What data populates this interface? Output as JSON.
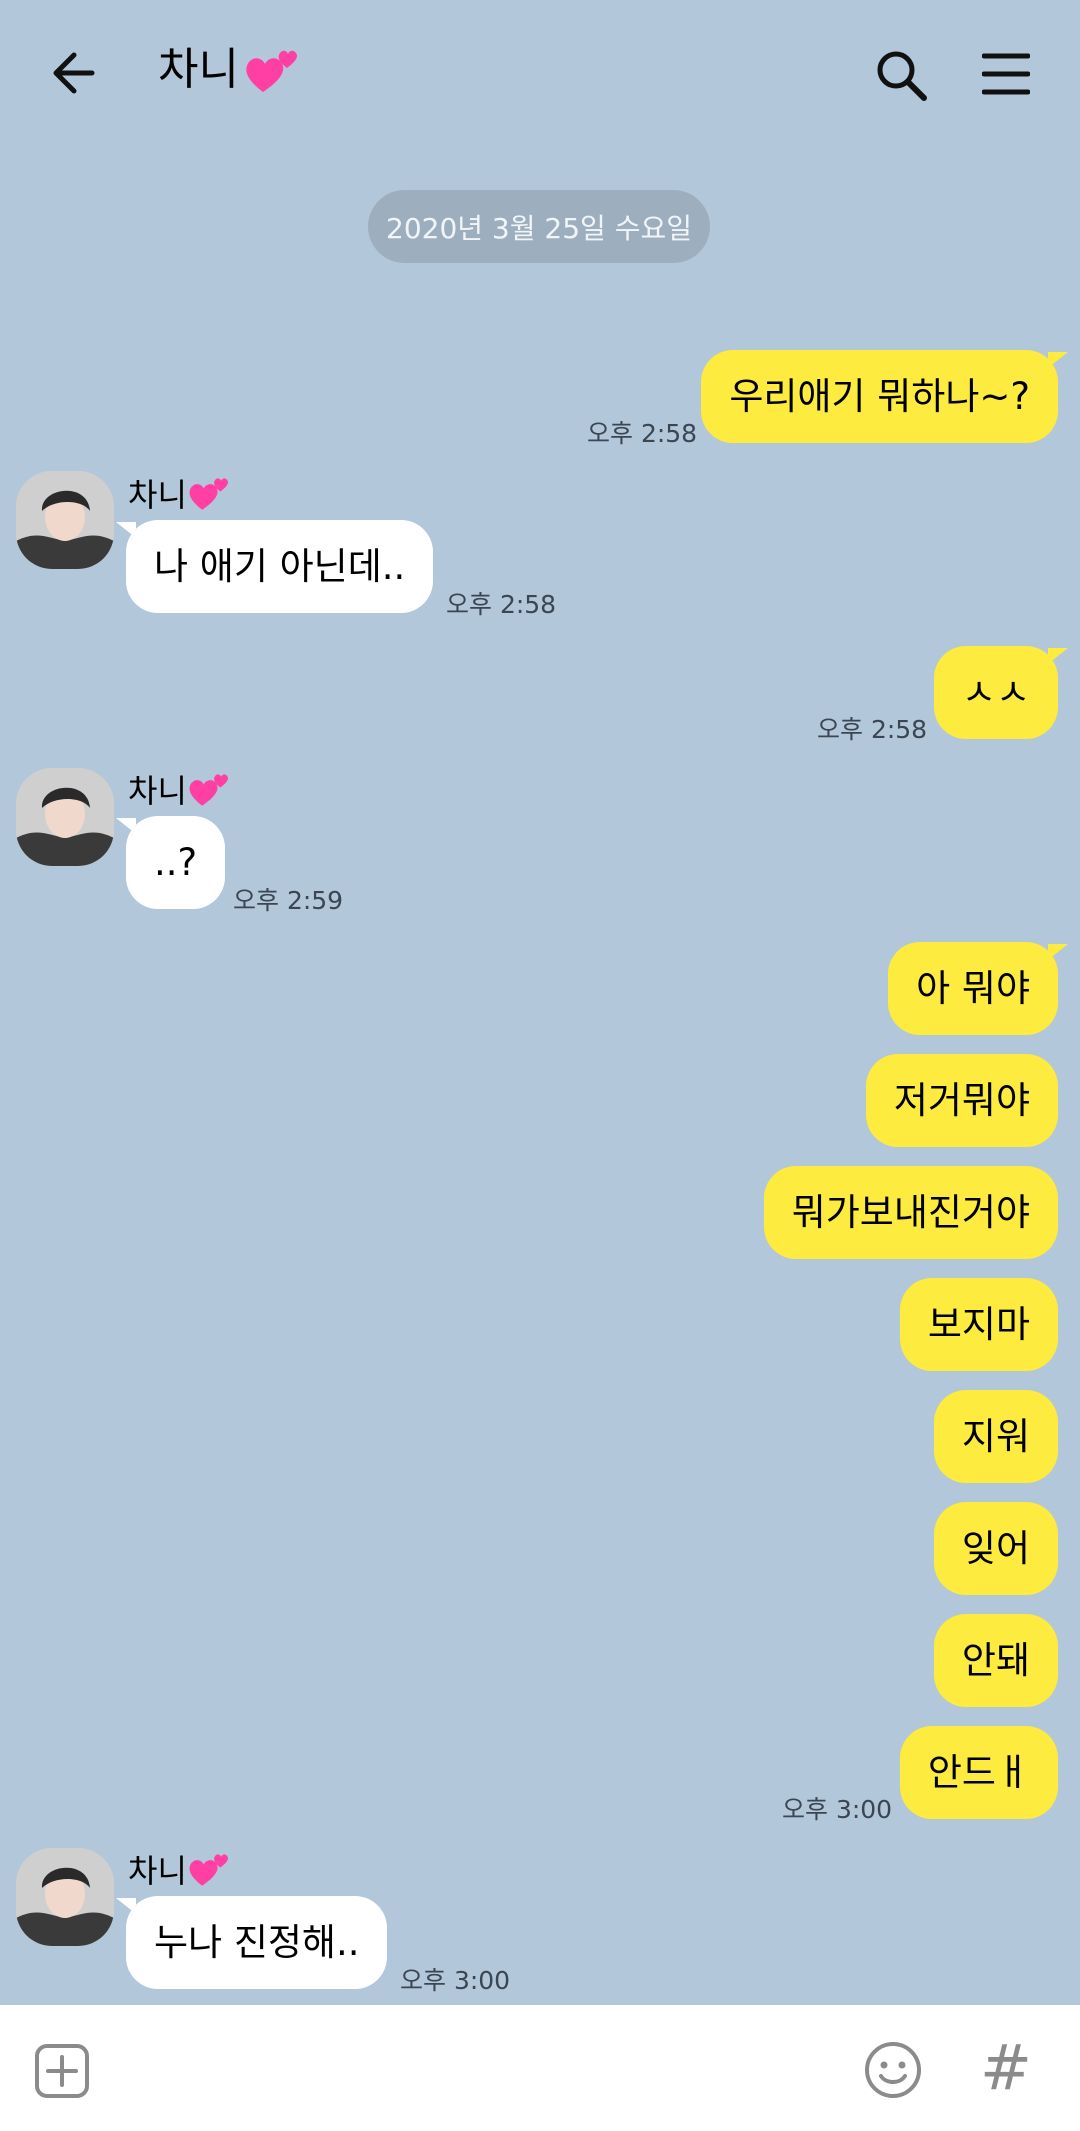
{
  "header": {
    "title": "차니",
    "back_icon": "arrow-left-icon",
    "search_icon": "search-icon",
    "menu_icon": "hamburger-menu-icon"
  },
  "date_divider": "2020년 3월 25일 수요일",
  "contact_name": "차니",
  "messages": [
    {
      "from": "me",
      "text": "우리애기 뭐하나~?",
      "time": "오후 2:58"
    },
    {
      "from": "them",
      "text": "나 애기 아닌데..",
      "time": "오후 2:58"
    },
    {
      "from": "me",
      "text": "ㅅㅅ",
      "time": "오후 2:58"
    },
    {
      "from": "them",
      "text": "..?",
      "time": "오후 2:59"
    },
    {
      "from": "me",
      "text": "아 뭐야"
    },
    {
      "from": "me",
      "text": "저거뭐야"
    },
    {
      "from": "me",
      "text": "뭐가보내진거야"
    },
    {
      "from": "me",
      "text": "보지마"
    },
    {
      "from": "me",
      "text": "지워"
    },
    {
      "from": "me",
      "text": "잊어"
    },
    {
      "from": "me",
      "text": "안돼"
    },
    {
      "from": "me",
      "text": "안드ㅐ",
      "time": "오후 3:00"
    },
    {
      "from": "them",
      "text": "누나 진정해..",
      "time": "오후 3:00"
    }
  ],
  "input_bar": {
    "plus_icon": "plus-square-icon",
    "emoji_icon": "smiley-icon",
    "hash_label": "#"
  },
  "colors": {
    "background": "#B2C7DA",
    "my_bubble": "#FEEB3F",
    "their_bubble": "#FFFFFF",
    "heart": "#FF3FA4"
  }
}
